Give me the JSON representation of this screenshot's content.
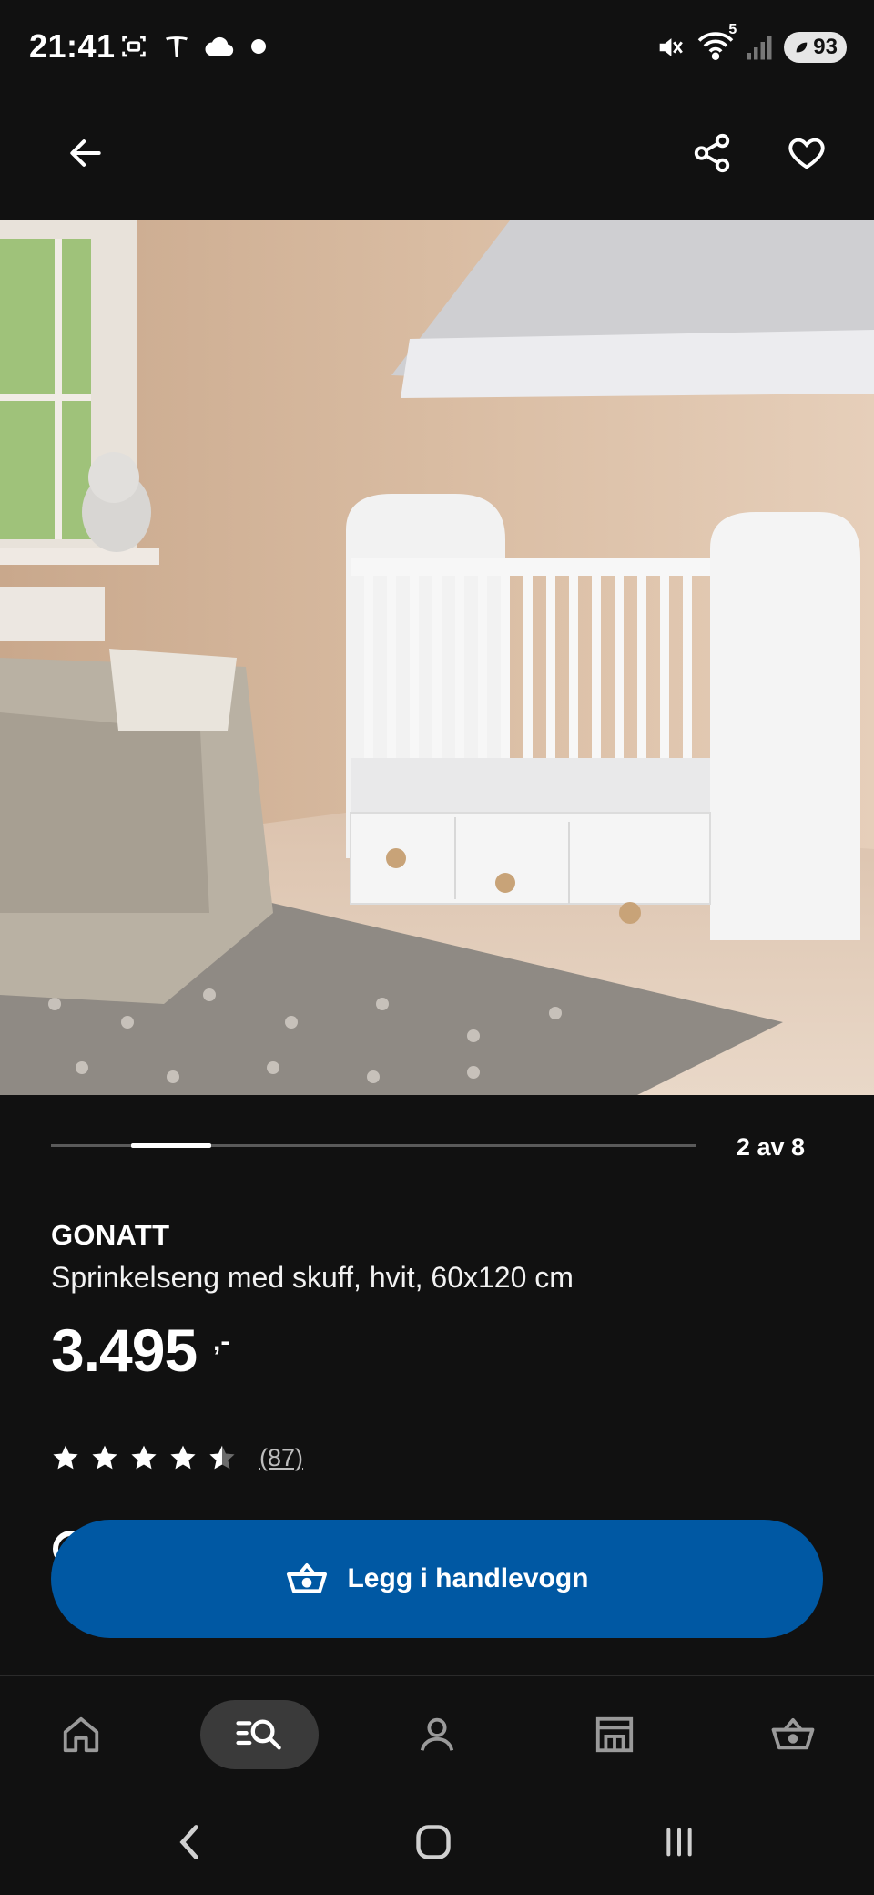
{
  "status_bar": {
    "time": "21:41",
    "battery": "93",
    "network": "5"
  },
  "product": {
    "brand": "GONATT",
    "description": "Sprinkelseng med skuff, hvit, 60x120 cm",
    "price": "3.495",
    "price_suffix": ",-",
    "rating_value": 4.5,
    "rating_max": 5,
    "rating_count": "(87)"
  },
  "gallery": {
    "position_label": "2 av 8",
    "current": 2,
    "total": 8
  },
  "actions": {
    "add_to_cart_label": "Legg i handlevogn"
  },
  "bottom_nav": {
    "items": [
      "home",
      "search",
      "profile",
      "store",
      "cart"
    ],
    "active": "search"
  },
  "colors": {
    "background": "#111111",
    "primary_button": "#0058a3",
    "text": "#ffffff",
    "muted": "#bdbdbd"
  }
}
